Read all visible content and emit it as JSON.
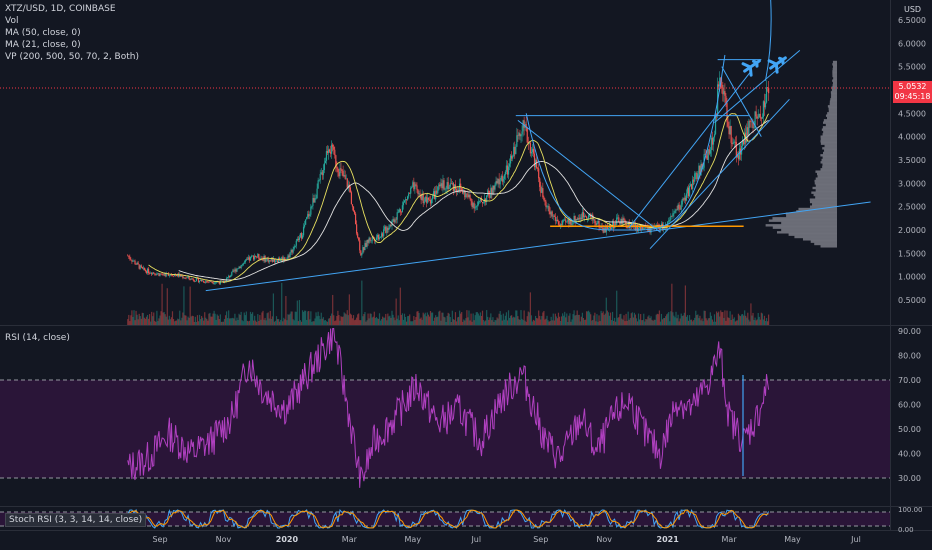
{
  "legend": {
    "symbol": "XTZ/USD, 1D, COINBASE",
    "vol": "Vol",
    "ma50": "MA (50, close, 0)",
    "ma21": "MA (21, close, 0)",
    "vp": "VP (200, 500, 50, 70, 2, Both)"
  },
  "last_price": {
    "value": "5.0532",
    "countdown": "09:45:18"
  },
  "rsi_label": "RSI (14, close)",
  "stoch_label": "Stoch RSI (3, 3, 14, 14, close)",
  "colors": {
    "background": "#131722",
    "up": "#26a69a",
    "down": "#ef5350",
    "ma50": "#e1e1e1",
    "ma21": "#e8e060",
    "trendline": "#42a5f5",
    "support": "#ff9800",
    "rsi": "#b040c0",
    "rsi_band": "#2a1538",
    "last_price": "#f23645"
  },
  "chart_data": [
    {
      "type": "candlestick",
      "title": "XTZ/USD, 1D, COINBASE",
      "ylabel": "USD",
      "x_ticks": [
        "Sep",
        "Nov",
        "2020",
        "Mar",
        "May",
        "Jul",
        "Sep",
        "Nov",
        "2021",
        "Mar",
        "May",
        "Jul"
      ],
      "y_ticks": [
        0.5,
        1.0,
        1.5,
        2.0,
        2.5,
        3.0,
        3.5,
        4.0,
        4.5,
        5.0,
        5.5,
        6.0,
        6.5
      ],
      "ylim": [
        0.2,
        6.75
      ],
      "last_price": 5.0532,
      "close_path": [
        [
          "2019-08-01",
          1.45
        ],
        [
          "2019-08-15",
          1.15
        ],
        [
          "2019-09-01",
          1.05
        ],
        [
          "2019-09-15",
          1.05
        ],
        [
          "2019-10-01",
          0.95
        ],
        [
          "2019-10-15",
          0.9
        ],
        [
          "2019-11-01",
          0.88
        ],
        [
          "2019-11-15",
          1.2
        ],
        [
          "2019-12-01",
          1.45
        ],
        [
          "2019-12-15",
          1.35
        ],
        [
          "2020-01-01",
          1.4
        ],
        [
          "2020-01-15",
          1.9
        ],
        [
          "2020-02-01",
          3.0
        ],
        [
          "2020-02-10",
          3.85
        ],
        [
          "2020-02-20",
          3.3
        ],
        [
          "2020-03-01",
          2.9
        ],
        [
          "2020-03-12",
          1.5
        ],
        [
          "2020-03-20",
          1.8
        ],
        [
          "2020-04-01",
          1.9
        ],
        [
          "2020-04-15",
          2.3
        ],
        [
          "2020-05-01",
          2.9
        ],
        [
          "2020-05-15",
          2.6
        ],
        [
          "2020-06-01",
          3.0
        ],
        [
          "2020-06-15",
          2.9
        ],
        [
          "2020-07-01",
          2.5
        ],
        [
          "2020-07-15",
          2.8
        ],
        [
          "2020-08-01",
          3.3
        ],
        [
          "2020-08-14",
          4.3
        ],
        [
          "2020-08-25",
          3.6
        ],
        [
          "2020-09-05",
          2.5
        ],
        [
          "2020-09-20",
          2.1
        ],
        [
          "2020-10-01",
          2.2
        ],
        [
          "2020-10-15",
          2.35
        ],
        [
          "2020-11-01",
          2.0
        ],
        [
          "2020-11-15",
          2.2
        ],
        [
          "2020-12-01",
          2.05
        ],
        [
          "2020-12-15",
          2.0
        ],
        [
          "2021-01-01",
          2.1
        ],
        [
          "2021-01-15",
          2.6
        ],
        [
          "2021-02-01",
          3.3
        ],
        [
          "2021-02-15",
          4.0
        ],
        [
          "2021-02-20",
          5.5
        ],
        [
          "2021-02-28",
          4.2
        ],
        [
          "2021-03-10",
          3.6
        ],
        [
          "2021-03-20",
          4.2
        ],
        [
          "2021-04-01",
          4.5
        ],
        [
          "2021-04-08",
          5.05
        ]
      ],
      "drawings": {
        "support_level": 2.08,
        "neckline": 4.45,
        "top_box_level": 5.65
      },
      "volume_profile": {
        "range": [
          1.65,
          5.6
        ],
        "poc": 2.1
      }
    },
    {
      "type": "line",
      "title": "RSI (14, close)",
      "y_ticks": [
        30,
        40,
        50,
        60,
        70,
        80,
        90
      ],
      "ylim": [
        25,
        92
      ],
      "bands": [
        30,
        70
      ],
      "points": [
        [
          "2019-08-01",
          34
        ],
        [
          "2019-08-20",
          38
        ],
        [
          "2019-09-10",
          48
        ],
        [
          "2019-10-01",
          40
        ],
        [
          "2019-10-20",
          45
        ],
        [
          "2019-11-10",
          55
        ],
        [
          "2019-11-25",
          78
        ],
        [
          "2019-12-10",
          65
        ],
        [
          "2020-01-01",
          58
        ],
        [
          "2020-01-20",
          72
        ],
        [
          "2020-02-05",
          82
        ],
        [
          "2020-02-15",
          90
        ],
        [
          "2020-03-01",
          55
        ],
        [
          "2020-03-12",
          28
        ],
        [
          "2020-03-25",
          45
        ],
        [
          "2020-04-15",
          55
        ],
        [
          "2020-05-05",
          68
        ],
        [
          "2020-05-25",
          52
        ],
        [
          "2020-06-15",
          58
        ],
        [
          "2020-07-05",
          45
        ],
        [
          "2020-07-25",
          62
        ],
        [
          "2020-08-14",
          73
        ],
        [
          "2020-09-05",
          45
        ],
        [
          "2020-09-20",
          38
        ],
        [
          "2020-10-10",
          55
        ],
        [
          "2020-10-25",
          40
        ],
        [
          "2020-11-10",
          55
        ],
        [
          "2020-11-25",
          62
        ],
        [
          "2020-12-10",
          48
        ],
        [
          "2020-12-25",
          40
        ],
        [
          "2021-01-10",
          62
        ],
        [
          "2021-01-25",
          58
        ],
        [
          "2021-02-10",
          70
        ],
        [
          "2021-02-20",
          82
        ],
        [
          "2021-03-01",
          55
        ],
        [
          "2021-03-15",
          45
        ],
        [
          "2021-03-28",
          55
        ],
        [
          "2021-04-08",
          69
        ]
      ]
    },
    {
      "type": "line",
      "title": "Stoch RSI (3, 3, 14, 14, close)",
      "y_ticks": [
        0,
        100
      ],
      "ylim": [
        0,
        100
      ],
      "bands": [
        20,
        80
      ]
    }
  ]
}
